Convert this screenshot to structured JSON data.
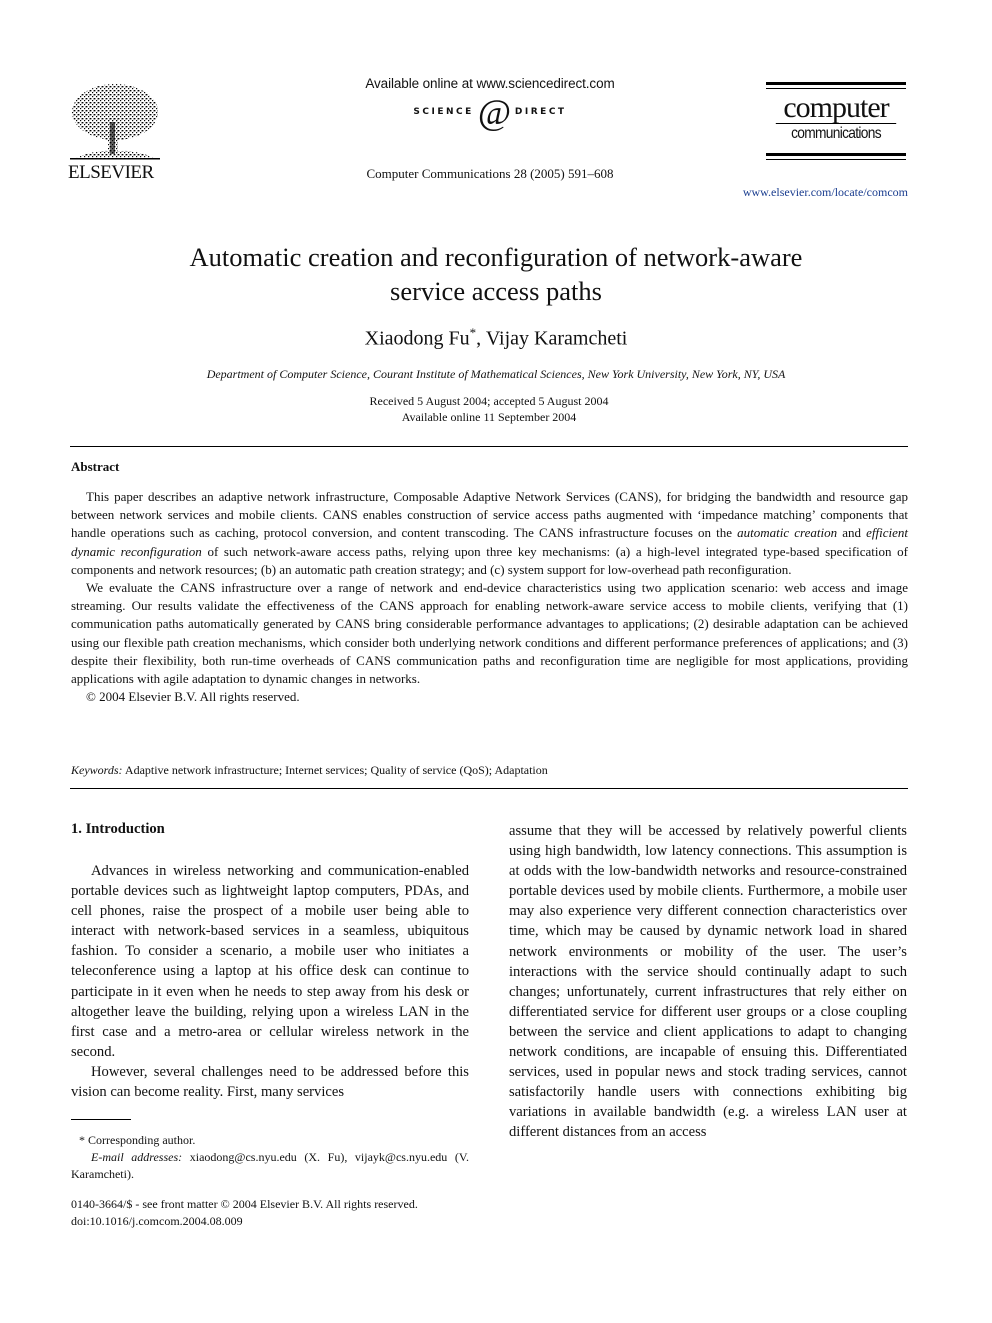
{
  "header": {
    "publisher": "ELSEVIER",
    "sd_available": "Available online at www.sciencedirect.com",
    "sd_logo_left": "SCIENCE",
    "sd_logo_at": "d",
    "sd_logo_right": "DIRECT",
    "sd_logo_tm": "®",
    "journal_ref": "Computer Communications 28 (2005) 591–608",
    "journal_logo_line1": "computer",
    "journal_logo_line2": "communications",
    "journal_url": "www.elsevier.com/locate/comcom"
  },
  "article": {
    "title_line1": "Automatic creation and reconfiguration of network-aware",
    "title_line2": "service access paths",
    "author1": "Xiaodong Fu",
    "author1_mark": "*",
    "author_sep": ", ",
    "author2": "Vijay Karamcheti",
    "affiliation": "Department of Computer Science, Courant Institute of Mathematical Sciences, New York University, New York, NY, USA",
    "received": "Received 5 August 2004; accepted 5 August 2004",
    "available": "Available online 11 September 2004"
  },
  "abstract": {
    "heading": "Abstract",
    "p1_a": "This paper describes an adaptive network infrastructure, Composable Adaptive Network Services (CANS), for bridging the bandwidth and resource gap between network services and mobile clients. CANS enables construction of service access paths augmented with ‘impedance matching’ components that handle operations such as caching, protocol conversion, and content transcoding. The CANS infrastructure focuses on the ",
    "p1_em1": "automatic creation",
    "p1_b": " and ",
    "p1_em2": "efficient dynamic reconfiguration",
    "p1_c": " of such network-aware access paths, relying upon three key mechanisms: (a) a high-level integrated type-based specification of components and network resources; (b) an automatic path creation strategy; and (c) system support for low-overhead path reconfiguration.",
    "p2": "We evaluate the CANS infrastructure over a range of network and end-device characteristics using two application scenario: web access and image streaming. Our results validate the effectiveness of the CANS approach for enabling network-aware service access to mobile clients, verifying that (1) communication paths automatically generated by CANS bring considerable performance advantages to applications; (2) desirable adaptation can be achieved using our flexible path creation mechanisms, which consider both underlying network conditions and different performance preferences of applications; and (3) despite their flexibility, both run-time overheads of CANS communication paths and reconfiguration time are negligible for most applications, providing applications with agile adaptation to dynamic changes in networks.",
    "copyright": "© 2004 Elsevier B.V. All rights reserved."
  },
  "keywords": {
    "label": "Keywords:",
    "text": " Adaptive network infrastructure; Internet services; Quality of service (QoS); Adaptation"
  },
  "body": {
    "section_heading": "1. Introduction",
    "left_p1": "Advances in wireless networking and communication-enabled portable devices such as lightweight laptop computers, PDAs, and cell phones, raise the prospect of a mobile user being able to interact with network-based services in a seamless, ubiquitous fashion. To consider a scenario, a mobile user who initiates a teleconference using a laptop at his office desk can continue to participate in it even when he needs to step away from his desk or altogether leave the building, relying upon a wireless LAN in the first case and a metro-area or cellular wireless network in the second.",
    "left_p2": "However, several challenges need to be addressed before this vision can become reality. First, many services",
    "right_p1": "assume that they will be accessed by relatively powerful clients using high bandwidth, low latency connections. This assumption is at odds with the low-bandwidth networks and resource-constrained portable devices used by mobile clients. Furthermore, a mobile user may also experience very different connection characteristics over time, which may be caused by dynamic network load in shared network environments or mobility of the user. The user’s interactions with the service should continually adapt to such changes; unfortunately, current infrastructures that rely either on differentiated service for different user groups or a close coupling between the service and client applications to adapt to changing network conditions, are incapable of ensuing this. Differentiated services, used in popular news and stock trading services, cannot satisfactorily handle users with connections exhibiting big variations in available bandwidth (e.g. a wireless LAN user at different distances from an access"
  },
  "footnotes": {
    "corresponding": "* Corresponding author.",
    "email_label": "E-mail addresses:",
    "email_text": " xiaodong@cs.nyu.edu (X. Fu), vijayk@cs.nyu.edu (V. Karamcheti).",
    "front_matter": "0140-3664/$ - see front matter © 2004 Elsevier B.V. All rights reserved.",
    "doi": "doi:10.1016/j.comcom.2004.08.009"
  }
}
